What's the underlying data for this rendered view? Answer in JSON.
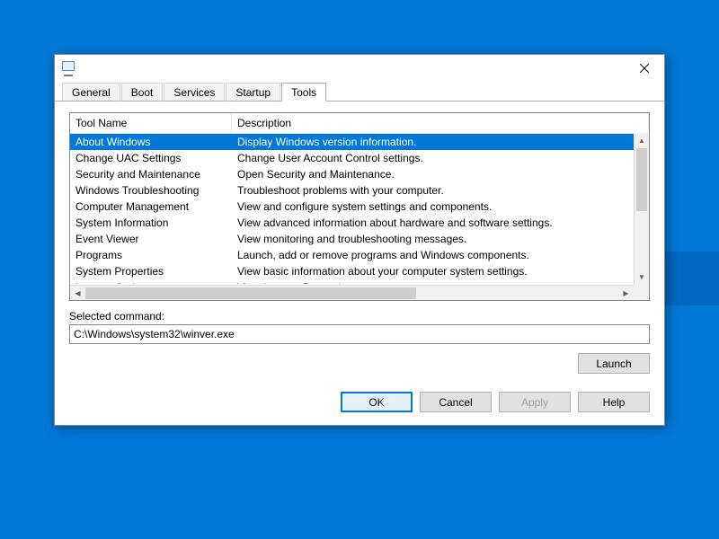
{
  "dialog": {
    "tabs": [
      {
        "label": "General",
        "active": false
      },
      {
        "label": "Boot",
        "active": false
      },
      {
        "label": "Services",
        "active": false
      },
      {
        "label": "Startup",
        "active": false
      },
      {
        "label": "Tools",
        "active": true
      }
    ],
    "columns": {
      "name": "Tool Name",
      "description": "Description"
    },
    "selected_index": 0,
    "tools": [
      {
        "name": "About Windows",
        "desc": "Display Windows version information."
      },
      {
        "name": "Change UAC Settings",
        "desc": "Change User Account Control settings."
      },
      {
        "name": "Security and Maintenance",
        "desc": "Open Security and Maintenance."
      },
      {
        "name": "Windows Troubleshooting",
        "desc": "Troubleshoot problems with your computer."
      },
      {
        "name": "Computer Management",
        "desc": "View and configure system settings and components."
      },
      {
        "name": "System Information",
        "desc": "View advanced information about hardware and software settings."
      },
      {
        "name": "Event Viewer",
        "desc": "View monitoring and troubleshooting messages."
      },
      {
        "name": "Programs",
        "desc": "Launch, add or remove programs and Windows components."
      },
      {
        "name": "System Properties",
        "desc": "View basic information about your computer system settings."
      },
      {
        "name": "Internet Options",
        "desc": "View Internet Properties."
      }
    ],
    "selected_label": "Selected command:",
    "selected_command": "C:\\Windows\\system32\\winver.exe",
    "buttons": {
      "launch": "Launch",
      "ok": "OK",
      "cancel": "Cancel",
      "apply": "Apply",
      "help": "Help"
    }
  }
}
